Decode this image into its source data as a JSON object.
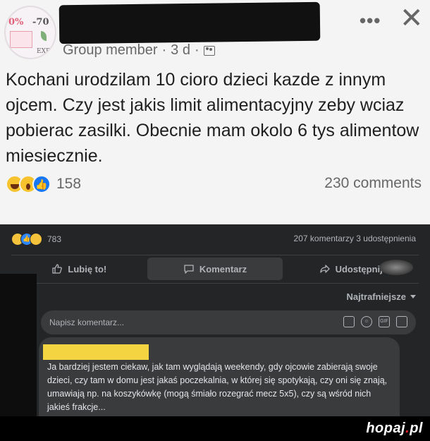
{
  "light_post": {
    "avatar": {
      "text_top_left": "0%",
      "text_top_right": "-70",
      "text_bottom": "EXP"
    },
    "meta": {
      "role": "Group member",
      "sep1": "·",
      "age": "3 d",
      "sep2": "·"
    },
    "menu_label": "•••",
    "close_label": "✕",
    "body": "Kochani urodzilam 10 cioro dzieci kazde z innym ojcem. Czy jest jakis limit alimentacyjny zeby wciaz pobierac zasilki. Obecnie mam okolo 6 tys alimentow miesiecznie.",
    "reaction_count": "158",
    "comments": "230 comments"
  },
  "dark_post": {
    "reaction_count": "783",
    "stats": "207 komentarzy  3 udostępnienia",
    "actions": {
      "like": "Lubię to!",
      "comment": "Komentarz",
      "share": "Udostępnij"
    },
    "sort_label": "Najtrafniejsze",
    "comment_placeholder": "Napisz komentarz...",
    "comment_text": "Ja bardziej jestem ciekaw, jak tam wyglądają weekendy, gdy ojcowie zabierają swoje dzieci, czy tam w domu jest jakaś poczekalnia, w której się spotykają, czy oni się znają, umawiają np. na koszykówkę (mogą śmiało rozegrać mecz 5x5), czy są wśród nich jakieś frakcje..."
  },
  "watermark": {
    "name": "hopaj",
    "dot": ".",
    "tld": "pl"
  },
  "colors": {
    "light_bg": "#f4f4f4",
    "dark_bg": "#242526",
    "like_blue": "#1878f3",
    "highlight": "#f5d442"
  }
}
